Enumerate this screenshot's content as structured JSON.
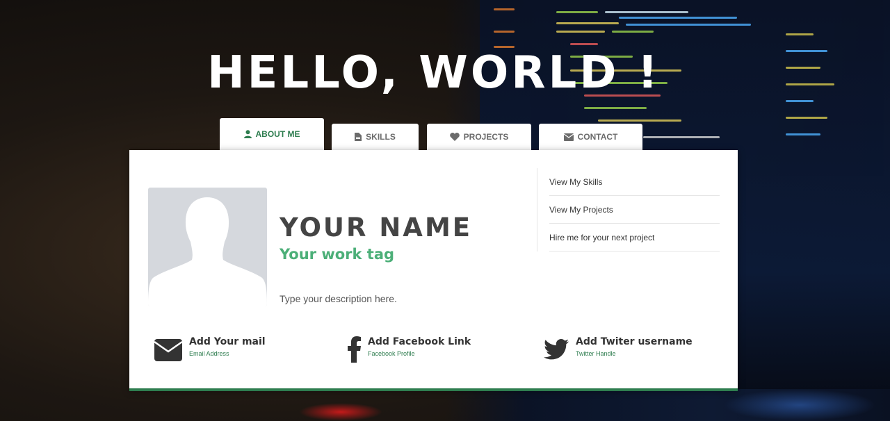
{
  "hero": {
    "title": "HELLO, WORLD !"
  },
  "tabs": [
    {
      "label": "ABOUT ME",
      "icon": "user-icon",
      "active": true
    },
    {
      "label": "SKILLS",
      "icon": "document-icon",
      "active": false
    },
    {
      "label": "PROJECTS",
      "icon": "heart-icon",
      "active": false
    },
    {
      "label": "CONTACT",
      "icon": "envelope-icon",
      "active": false
    }
  ],
  "profile": {
    "avatar_icon": "avatar-placeholder-icon",
    "name": "YOUR NAME",
    "work_tag": "Your work tag",
    "description": "Type your description here."
  },
  "side_links": [
    {
      "label": "View My Skills"
    },
    {
      "label": "View My Projects"
    },
    {
      "label": "Hire me for your next project"
    }
  ],
  "contacts": [
    {
      "title": "Add Your mail",
      "subtitle": "Email Address",
      "icon": "envelope-icon"
    },
    {
      "title": "Add Facebook Link",
      "subtitle": "Facebook Profile",
      "icon": "facebook-icon"
    },
    {
      "title": "Add Twiter username",
      "subtitle": "Twitter Handle",
      "icon": "twitter-icon"
    }
  ],
  "colors": {
    "accent": "#2e7d4f",
    "accent_light": "#4caf78",
    "card_background": "#ffffff",
    "text_dark": "#444444"
  }
}
